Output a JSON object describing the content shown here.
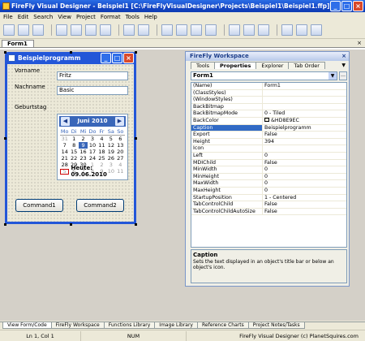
{
  "window": {
    "title": "FireFly Visual Designer - Beispiel1 [C:\\FireFlyVisualDesigner\\Projects\\Beispiel1\\Beispiel1.ffp]"
  },
  "menu": [
    "File",
    "Edit",
    "Search",
    "View",
    "Project",
    "Format",
    "Tools",
    "Help"
  ],
  "doc_tab": "Form1",
  "form": {
    "title": "Beispielprogramm",
    "vorname_label": "Vorname",
    "vorname_value": "Fritz",
    "nachname_label": "Nachname",
    "nachname_value": "Basic",
    "geburtstag_label": "Geburtstag",
    "command1": "Command1",
    "command2": "Command2"
  },
  "calendar": {
    "month": "Juni 2010",
    "prev": "◀",
    "next": "▶",
    "days": [
      "Mo",
      "Di",
      "Mi",
      "Do",
      "Fr",
      "Sa",
      "So"
    ],
    "weeks": [
      [
        "31",
        "1",
        "2",
        "3",
        "4",
        "5",
        "6"
      ],
      [
        "7",
        "8",
        "9",
        "10",
        "11",
        "12",
        "13"
      ],
      [
        "14",
        "15",
        "16",
        "17",
        "18",
        "19",
        "20"
      ],
      [
        "21",
        "22",
        "23",
        "24",
        "25",
        "26",
        "27"
      ],
      [
        "28",
        "29",
        "30",
        "1",
        "2",
        "3",
        "4"
      ],
      [
        "5",
        "6",
        "7",
        "8",
        "9",
        "10",
        "11"
      ]
    ],
    "today": "Heute: 09.06.2010"
  },
  "workspace": {
    "title": "FireFly Workspace",
    "tabs": [
      "Tools",
      "Properties",
      "Explorer",
      "Tab Order"
    ],
    "object": "Form1",
    "props": [
      [
        "(Name)",
        "Form1"
      ],
      [
        "(ClassStyles)",
        ""
      ],
      [
        "(WindowStyles)",
        ""
      ],
      [
        "BackBitmap",
        ""
      ],
      [
        "BackBitmapMode",
        "0 - Tiled"
      ],
      [
        "BackColor",
        "&HD8E9EC"
      ],
      [
        "Caption",
        "Beispielprogramm"
      ],
      [
        "Export",
        "False"
      ],
      [
        "Height",
        "394"
      ],
      [
        "Icon",
        ""
      ],
      [
        "Left",
        "0"
      ],
      [
        "MDIChild",
        "False"
      ],
      [
        "MinWidth",
        "0"
      ],
      [
        "MinHeight",
        "0"
      ],
      [
        "MaxWidth",
        "0"
      ],
      [
        "MaxHeight",
        "0"
      ],
      [
        "StartupPosition",
        "1 - Centered"
      ],
      [
        "TabControlChild",
        "False"
      ],
      [
        "TabControlChildAutoSize",
        "False"
      ]
    ],
    "desc_title": "Caption",
    "desc_text": "Sets the text displayed in an object's title bar or below an object's icon."
  },
  "bottom_tabs": [
    "View Form/Code",
    "FireFly Workspace",
    "Functions Library",
    "Image Library",
    "Reference Charts",
    "Project Notes/Tasks"
  ],
  "status": {
    "pos": "Ln 1,  Col 1",
    "num": "NUM",
    "credit": "FireFly Visual Designer (c) PlanetSquires.com"
  }
}
